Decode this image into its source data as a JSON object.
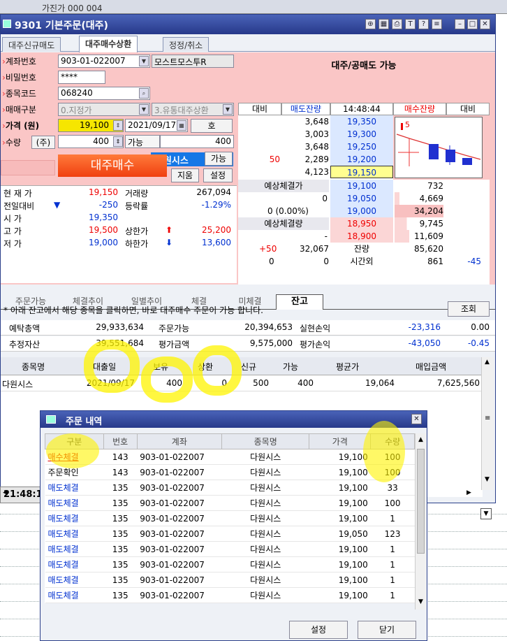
{
  "top_strip": {
    "text": "가진가 000 004"
  },
  "window": {
    "title": "9301 기본주문(대주)",
    "tabs": [
      {
        "label": "대주신규매도"
      },
      {
        "label": "대주매수상환"
      },
      {
        "label": "정정/취소"
      }
    ]
  },
  "order": {
    "account_label": "계좌번호",
    "account_value": "903-01-022007",
    "account_name": "모스트모스투R",
    "password_label": "비밀번호",
    "password_value": "****",
    "code_label": "종목코드",
    "code_value": "068240",
    "stock_name": "다원시스",
    "trade_type_label": "매매구분",
    "trade_type_value": "0.지정가",
    "credit_value": "3.유통대주상환",
    "price_label": "가격 (원)",
    "price_value": "19,100",
    "date_value": "2021/09/17",
    "quote_btn": "호",
    "qty_label": "수량",
    "qty_unit": "(주)",
    "qty_value": "400",
    "avail_label": "가능",
    "avail_value": "400",
    "avail_btn": "가능",
    "buy_btn": "대주매수",
    "clear_btn": "지움",
    "settings_btn": "설정"
  },
  "quote": {
    "current_label": "현 재 가",
    "current": "19,150",
    "change_label": "전일대비",
    "change_arrow": "▼",
    "change": "-250",
    "open_label": "시    가",
    "open": "19,350",
    "high_label": "고    가",
    "high": "19,500",
    "low_label": "저    가",
    "low": "19,000",
    "volume_label": "거래량",
    "volume": "267,094",
    "rate_label": "등락률",
    "rate": "-1.29%",
    "upper_label": "상한가",
    "upper_arrow": "⬆",
    "upper": "25,200",
    "lower_label": "하한가",
    "lower_arrow": "⬇",
    "lower": "13,600"
  },
  "orderbook": {
    "title": "대주/공매도 가능",
    "headers": {
      "diff": "대비",
      "ask": "매도잔량",
      "time": "14:48:44",
      "bid": "매수잔량",
      "diff2": "대비"
    },
    "asks": [
      {
        "diff": "",
        "qty": "3,648",
        "price": "19,350"
      },
      {
        "diff": "",
        "qty": "3,003",
        "price": "19,300"
      },
      {
        "diff": "",
        "qty": "3,648",
        "price": "19,250"
      },
      {
        "diff": "50",
        "qty": "2,289",
        "price": "19,200"
      },
      {
        "diff": "",
        "qty": "4,123",
        "price": "19,150"
      }
    ],
    "exp_price_label": "예상체결가",
    "exp_price": "0",
    "exp_rate": "0  (0.00%)",
    "exp_qty_label": "예상체결량",
    "exp_qty": "-",
    "bids": [
      {
        "price": "19,100",
        "qty": "732"
      },
      {
        "price": "19,050",
        "qty": "4,669"
      },
      {
        "price": "19,000",
        "qty": "34,204"
      },
      {
        "price": "18,950",
        "qty": "9,745"
      },
      {
        "price": "18,900",
        "qty": "11,609"
      }
    ],
    "total_diff": "+50",
    "total_ask": "32,067",
    "total_label": "잔량",
    "total_bid": "85,620",
    "after_a": "0",
    "after_b": "0",
    "after_label": "시간외",
    "after_bid": "861",
    "after_diff": "-45",
    "chart_marker": "5"
  },
  "lower_tabs": [
    {
      "label": "주문가능"
    },
    {
      "label": "체결추이"
    },
    {
      "label": "일별추이"
    },
    {
      "label": "체결"
    },
    {
      "label": "미체결"
    },
    {
      "label": "잔고"
    }
  ],
  "notice": "* 아래 잔고에서 해당 종목을 클릭하면, 바로 대주매수 주문이 가능 합니다.",
  "query_btn": "조회",
  "summary": {
    "deposit_label": "예탁총액",
    "deposit": "29,933,634",
    "orderable_label": "주문가능",
    "orderable": "20,394,653",
    "realized_label": "실현손익",
    "realized": "-23,316",
    "realized_rate": "0.00",
    "est_label": "추정자산",
    "est": "39,551,684",
    "eval_label": "평가금액",
    "eval": "9,575,000",
    "unreal_label": "평가손익",
    "unreal": "-43,050",
    "unreal_rate": "-0.45"
  },
  "holdings": {
    "headers": [
      "종목명",
      "대출일",
      "보유",
      "상환",
      "신규",
      "가능",
      "평균가",
      "매입금액"
    ],
    "rows": [
      [
        "다원시스",
        "2021/09/17",
        "400",
        "0",
        "500",
        "400",
        "19,064",
        "7,625,560"
      ]
    ]
  },
  "status_time": "21:48:1",
  "popup": {
    "title": "주문 내역",
    "headers": [
      "구분",
      "번호",
      "계좌",
      "종목명",
      "가격",
      "수량"
    ],
    "rows": [
      [
        "매수체결",
        "143",
        "903-01-022007",
        "다원시스",
        "19,100",
        "100"
      ],
      [
        "주문확인",
        "143",
        "903-01-022007",
        "다원시스",
        "19,100",
        "100"
      ],
      [
        "매도체결",
        "135",
        "903-01-022007",
        "다원시스",
        "19,100",
        "33"
      ],
      [
        "매도체결",
        "135",
        "903-01-022007",
        "다원시스",
        "19,100",
        "100"
      ],
      [
        "매도체결",
        "135",
        "903-01-022007",
        "다원시스",
        "19,100",
        "1"
      ],
      [
        "매도체결",
        "135",
        "903-01-022007",
        "다원시스",
        "19,050",
        "123"
      ],
      [
        "매도체결",
        "135",
        "903-01-022007",
        "다원시스",
        "19,100",
        "1"
      ],
      [
        "매도체결",
        "135",
        "903-01-022007",
        "다원시스",
        "19,100",
        "1"
      ],
      [
        "매도체결",
        "135",
        "903-01-022007",
        "다원시스",
        "19,100",
        "1"
      ],
      [
        "매도체결",
        "135",
        "903-01-022007",
        "다원시스",
        "19,100",
        "1"
      ]
    ],
    "settings_btn": "설정",
    "close_btn": "닫기"
  },
  "colors": {
    "accent": "#27398a",
    "pink": "#fac6c6",
    "buy": "#e00000",
    "sell": "#0030d0",
    "highlight": "#fff400"
  }
}
